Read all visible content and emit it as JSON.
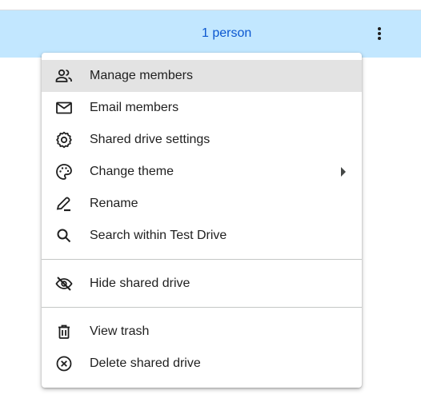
{
  "row": {
    "members_text": "1 person",
    "more_actions_icon": "more-vert-icon",
    "highlight_color": "#c2e7ff",
    "text_color": "#0b57d0"
  },
  "menu": {
    "items": [
      {
        "label": "Manage members",
        "icon": "manage-members-icon",
        "highlighted": true
      },
      {
        "label": "Email members",
        "icon": "email-icon"
      },
      {
        "label": "Shared drive settings",
        "icon": "settings-gear-icon"
      },
      {
        "label": "Change theme",
        "icon": "palette-icon",
        "has_submenu": true
      },
      {
        "label": "Rename",
        "icon": "pencil-icon"
      },
      {
        "label": "Search within Test Drive",
        "icon": "search-icon"
      },
      {
        "label": "Hide shared drive",
        "icon": "hide-eye-icon"
      },
      {
        "label": "View trash",
        "icon": "trash-icon"
      },
      {
        "label": "Delete shared drive",
        "icon": "delete-circle-x-icon"
      }
    ]
  }
}
